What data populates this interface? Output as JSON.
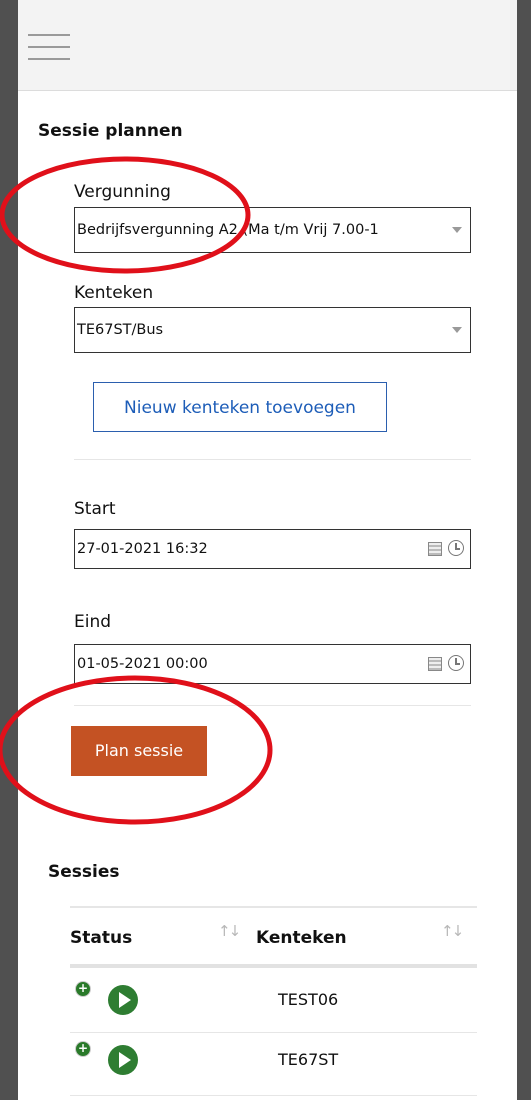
{
  "form": {
    "title": "Sessie plannen",
    "vergunning": {
      "label": "Vergunning",
      "value": "Bedrijfsvergunning A2 (Ma t/m Vrij 7.00-1"
    },
    "kenteken": {
      "label": "Kenteken",
      "value": "TE67ST/Bus"
    },
    "add_kenteken_label": "Nieuw kenteken toevoegen",
    "start": {
      "label": "Start",
      "value": "27-01-2021 16:32"
    },
    "eind": {
      "label": "Eind",
      "value": "01-05-2021 00:00"
    },
    "plan_label": "Plan sessie",
    "primary_color": "#c45223",
    "link_color": "#1d5db8"
  },
  "sessions": {
    "title": "Sessies",
    "columns": [
      "Status",
      "Kenteken"
    ],
    "rows": [
      {
        "kenteken": "TEST06",
        "status_icon": "play-icon"
      },
      {
        "kenteken": "TE67ST",
        "status_icon": "play-icon"
      }
    ]
  },
  "icons": {
    "menu": "hamburger-menu-icon",
    "calendar": "calendar-icon",
    "clock": "clock-icon",
    "sort": "sort-arrows-icon",
    "expand": "plus-circle-icon"
  },
  "annotation_color": "#e0101a"
}
